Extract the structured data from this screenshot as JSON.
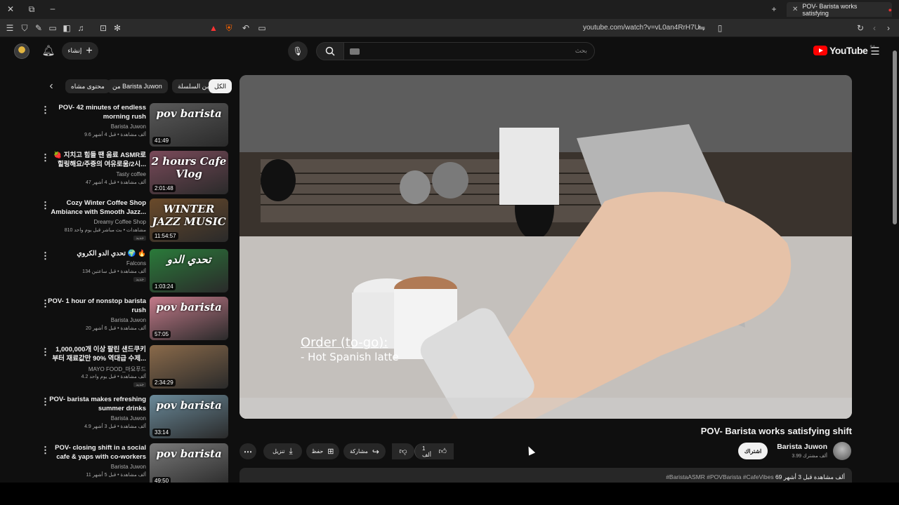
{
  "browser": {
    "tab_title": "POV- Barista works satisfying",
    "url": "youtube.com/watch?v=vL0an4RrH7U"
  },
  "header": {
    "search_placeholder": "بحث",
    "create_label": "إنشاء",
    "logo_text": "YouTube",
    "logo_country": "SA"
  },
  "chips": {
    "all": "الكل",
    "from_series": "من السلسلة",
    "from_channel": "من Barista Juwon",
    "watched": "محتوى مشاه"
  },
  "sidebar": {
    "items": [
      {
        "title": "POV- 42 minutes of endless morning rush",
        "channel": "Barista Juwon",
        "meta": "9.6 ألف مشاهدة • قبل 4 أشهر",
        "duration": "41:49",
        "thumb_label": "pov barista",
        "thumb_color": "#5a5a5a"
      },
      {
        "title": "🍓 지치고 힘들 땐 음료 ASMR로 힐링해요/주중의 여유로움/2시...",
        "channel": "Tasty coffee",
        "meta": "47 ألف مشاهدة • قبل 4 أشهر",
        "duration": "2:01:48",
        "thumb_label": "2 hours Cafe Vlog",
        "thumb_color": "#7a4a5a"
      },
      {
        "title": "Cozy Winter Coffee Shop Ambiance with Smooth Jazz...",
        "channel": "Dreamy Coffee Shop",
        "meta": "810 مشاهدات • بث مباشر قبل يوم واحد",
        "duration": "11:54:57",
        "thumb_label": "WINTER JAZZ MUSIC",
        "thumb_color": "#6a4a2a",
        "badge": "جديد"
      },
      {
        "title": "تحدي الدو الكروي 🌍 🔥",
        "channel": "Falcons",
        "meta": "134 ألف مشاهدة • قبل ساعتين",
        "duration": "1:03:24",
        "thumb_label": "تحدي الدو",
        "thumb_color": "#2a7a3a",
        "badge": "جديد"
      },
      {
        "title": "POV- 1 hour of nonstop barista rush",
        "channel": "Barista Juwon",
        "meta": "20 ألف مشاهدة • قبل 6 أشهر",
        "duration": "57:05",
        "thumb_label": "pov barista",
        "thumb_color": "#c47a8a"
      },
      {
        "title": "1,000,000개 이상 팔린 샌드쿠키 부터 재료값만 90% 역대급 수제...",
        "channel": "MAYO FOOD_마요푸드",
        "meta": "4.2 ألف مشاهدة • قبل يوم واحد",
        "duration": "2:34:29",
        "thumb_label": "",
        "thumb_color": "#8a6a4a",
        "badge": "جديد"
      },
      {
        "title": "POV- barista makes refreshing summer drinks",
        "channel": "Barista Juwon",
        "meta": "4.9 ألف مشاهدة • قبل 3 أشهر",
        "duration": "33:14",
        "thumb_label": "pov barista",
        "thumb_color": "#6a8a9a"
      },
      {
        "title": "POV- closing shift in a social cafe & yaps with co-workers",
        "channel": "Barista Juwon",
        "meta": "11 ألف مشاهدة • قبل 5 أشهر",
        "duration": "49:50",
        "thumb_label": "pov barista",
        "thumb_color": "#7a7a7a"
      }
    ]
  },
  "video": {
    "overlay_line1": "Order (to-go):",
    "overlay_line2": "- Hot Spanish latte",
    "title": "POV- Barista works satisfying shift",
    "channel": "Barista Juwon",
    "subscribers": "3.99 ألف مشترك",
    "subscribe_label": "اشتراك",
    "like_count": "1 ألف",
    "share_label": "مشاركة",
    "save_label": "حفظ",
    "download_label": "تنزيل",
    "views_date": "69 ألف مشاهدة قبل 3 أشهر",
    "tags": "#BaristaASMR #POVBarista #CafeVibes"
  }
}
